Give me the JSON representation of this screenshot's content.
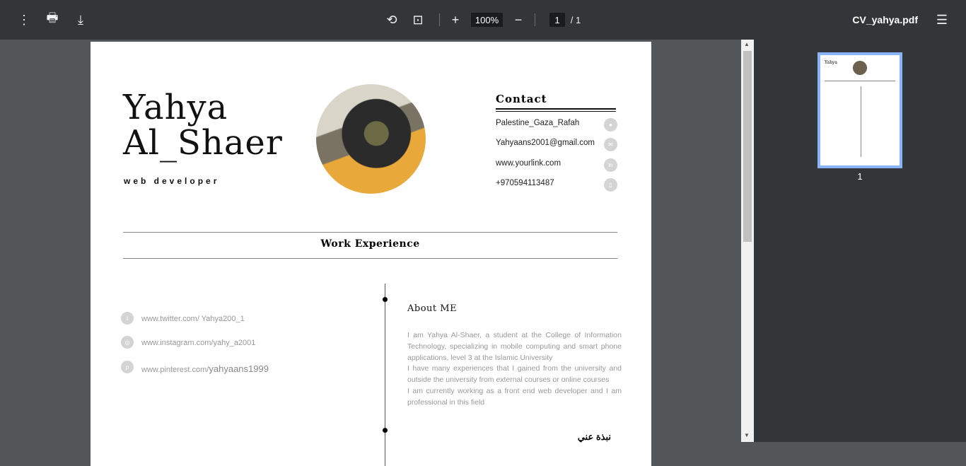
{
  "toolbar": {
    "title": "CV_yahya.pdf",
    "zoom": "100%",
    "page_current": "1",
    "page_total": "/ 1"
  },
  "cv": {
    "name_line1": "Yahya",
    "name_line2": "Al_Shaer",
    "role": "web developer",
    "contact_heading": "Contact",
    "contacts": [
      {
        "text": "Palestine_Gaza_Rafah",
        "icon": "map-pin-icon"
      },
      {
        "text": "Yahyaans2001@gmail.com",
        "icon": "mail-icon"
      },
      {
        "text": "www.yourlink.com",
        "icon": "linkedin-icon"
      },
      {
        "text": "+970594113487",
        "icon": "phone-icon"
      }
    ],
    "work_heading": "Work Experience",
    "socials": [
      {
        "text": "www.twitter.com/ Yahya200_1",
        "icon": "twitter-icon"
      },
      {
        "text": "www.instagram.com/yahy_a2001",
        "icon": "instagram-icon"
      },
      {
        "text_prefix": "www.pinterest.com/",
        "text_handle": "yahyaans1999",
        "icon": "pinterest-icon"
      }
    ],
    "about_heading": "About ME",
    "about_lines": [
      "I am Yahya Al-Shaer, a student at the College of Information Technology, specializing in mobile computing and smart phone applications, level 3 at the Islamic University",
      "I have many experiences that I gained from the university and outside the university from external courses or online courses",
      "I am currently working as a front end web developer and I am professional in this field"
    ],
    "arabic_heading": "نبذة عني"
  },
  "sidebar": {
    "thumb_label": "1"
  }
}
